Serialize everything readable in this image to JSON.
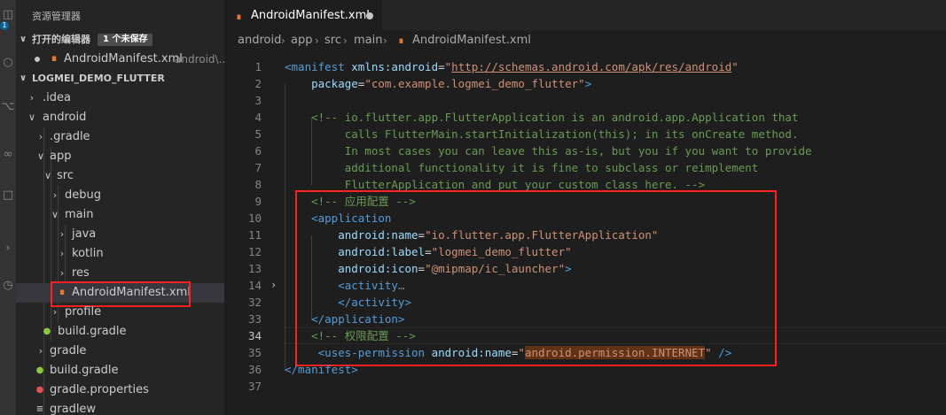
{
  "activity_bar": {
    "badge": "1"
  },
  "sidebar": {
    "title": "资源管理器",
    "open_editors": {
      "label": "打开的编辑器",
      "badge": "1 个未保存",
      "file": "AndroidManifest.xml",
      "path": "android\\..."
    },
    "project": {
      "label": "LOGMEI_DEMO_FLUTTER",
      "items": [
        {
          "label": ".idea"
        },
        {
          "label": "android"
        },
        {
          "label": ".gradle"
        },
        {
          "label": "app"
        },
        {
          "label": "src"
        },
        {
          "label": "debug"
        },
        {
          "label": "main"
        },
        {
          "label": "java"
        },
        {
          "label": "kotlin"
        },
        {
          "label": "res"
        },
        {
          "label": "AndroidManifest.xml"
        },
        {
          "label": "profile"
        },
        {
          "label": "build.gradle"
        },
        {
          "label": "gradle"
        },
        {
          "label": "build.gradle"
        },
        {
          "label": "gradle.properties"
        },
        {
          "label": "gradlew"
        }
      ]
    }
  },
  "tabs": [
    {
      "label": "AndroidManifest.xml"
    }
  ],
  "breadcrumb": [
    "android",
    "app",
    "src",
    "main",
    "AndroidManifest.xml"
  ],
  "editor": {
    "lines": [
      {
        "n": "1",
        "tokens": [
          [
            "t-tag",
            "<manifest "
          ],
          [
            "t-attr",
            "xmlns:android"
          ],
          [
            "",
            "="
          ],
          [
            "t-str",
            "\""
          ],
          [
            "t-url",
            "http://schemas.android.com/apk/res/android"
          ],
          [
            "t-str",
            "\""
          ]
        ]
      },
      {
        "n": "2",
        "tokens": [
          [
            "",
            "    "
          ],
          [
            "t-attr",
            "package"
          ],
          [
            "",
            "="
          ],
          [
            "t-str",
            "\"com.example.logmei_demo_flutter\""
          ],
          [
            "t-tag",
            ">"
          ]
        ]
      },
      {
        "n": "3",
        "tokens": [
          [
            "",
            ""
          ]
        ]
      },
      {
        "n": "4",
        "tokens": [
          [
            "t-cmt",
            "    <!-- io.flutter.app.FlutterApplication is an android.app.Application that"
          ]
        ]
      },
      {
        "n": "5",
        "tokens": [
          [
            "t-cmt",
            "         calls FlutterMain.startInitialization(this); in its onCreate method."
          ]
        ]
      },
      {
        "n": "6",
        "tokens": [
          [
            "t-cmt",
            "         In most cases you can leave this as-is, but you if you want to provide"
          ]
        ]
      },
      {
        "n": "7",
        "tokens": [
          [
            "t-cmt",
            "         additional functionality it is fine to subclass or reimplement"
          ]
        ]
      },
      {
        "n": "8",
        "tokens": [
          [
            "t-cmt",
            "         FlutterApplication and put your custom class here. -->"
          ]
        ]
      },
      {
        "n": "9",
        "tokens": [
          [
            "t-cmt",
            "    <!-- 应用配置 -->"
          ]
        ]
      },
      {
        "n": "10",
        "tokens": [
          [
            "t-tag",
            "    <application"
          ]
        ]
      },
      {
        "n": "11",
        "tokens": [
          [
            "",
            "        "
          ],
          [
            "t-attr",
            "android:name"
          ],
          [
            "",
            "="
          ],
          [
            "t-str",
            "\"io.flutter.app.FlutterApplication\""
          ]
        ]
      },
      {
        "n": "12",
        "tokens": [
          [
            "",
            "        "
          ],
          [
            "t-attr",
            "android:label"
          ],
          [
            "",
            "="
          ],
          [
            "t-str",
            "\"logmei_demo_flutter\""
          ]
        ]
      },
      {
        "n": "13",
        "tokens": [
          [
            "",
            "        "
          ],
          [
            "t-attr",
            "android:icon"
          ],
          [
            "",
            "="
          ],
          [
            "t-str",
            "\"@mipmap/ic_launcher\""
          ],
          [
            "t-tag",
            ">"
          ]
        ]
      },
      {
        "n": "14",
        "tokens": [
          [
            "t-tag",
            "        <activity"
          ],
          [
            "t-punc",
            "…"
          ]
        ]
      },
      {
        "n": "32",
        "tokens": [
          [
            "t-tag",
            "        </activity>"
          ]
        ]
      },
      {
        "n": "33",
        "tokens": [
          [
            "t-tag",
            "    </application>"
          ]
        ]
      },
      {
        "n": "34",
        "tokens": [
          [
            "t-cmt",
            "    <!-- 权限配置 -->"
          ]
        ]
      },
      {
        "n": "35",
        "tokens": [
          [
            "",
            "     "
          ],
          [
            "t-tag",
            "<uses-permission "
          ],
          [
            "t-attr",
            "android:name"
          ],
          [
            "",
            "="
          ],
          [
            "t-str",
            "\""
          ],
          [
            "t-str t-hl",
            "android.permission.INTERNET"
          ],
          [
            "t-str",
            "\""
          ],
          [
            "t-tag",
            " />"
          ]
        ]
      },
      {
        "n": "36",
        "tokens": [
          [
            "t-tag",
            "</manifest>"
          ]
        ]
      },
      {
        "n": "37",
        "tokens": [
          [
            "",
            ""
          ]
        ]
      }
    ]
  }
}
